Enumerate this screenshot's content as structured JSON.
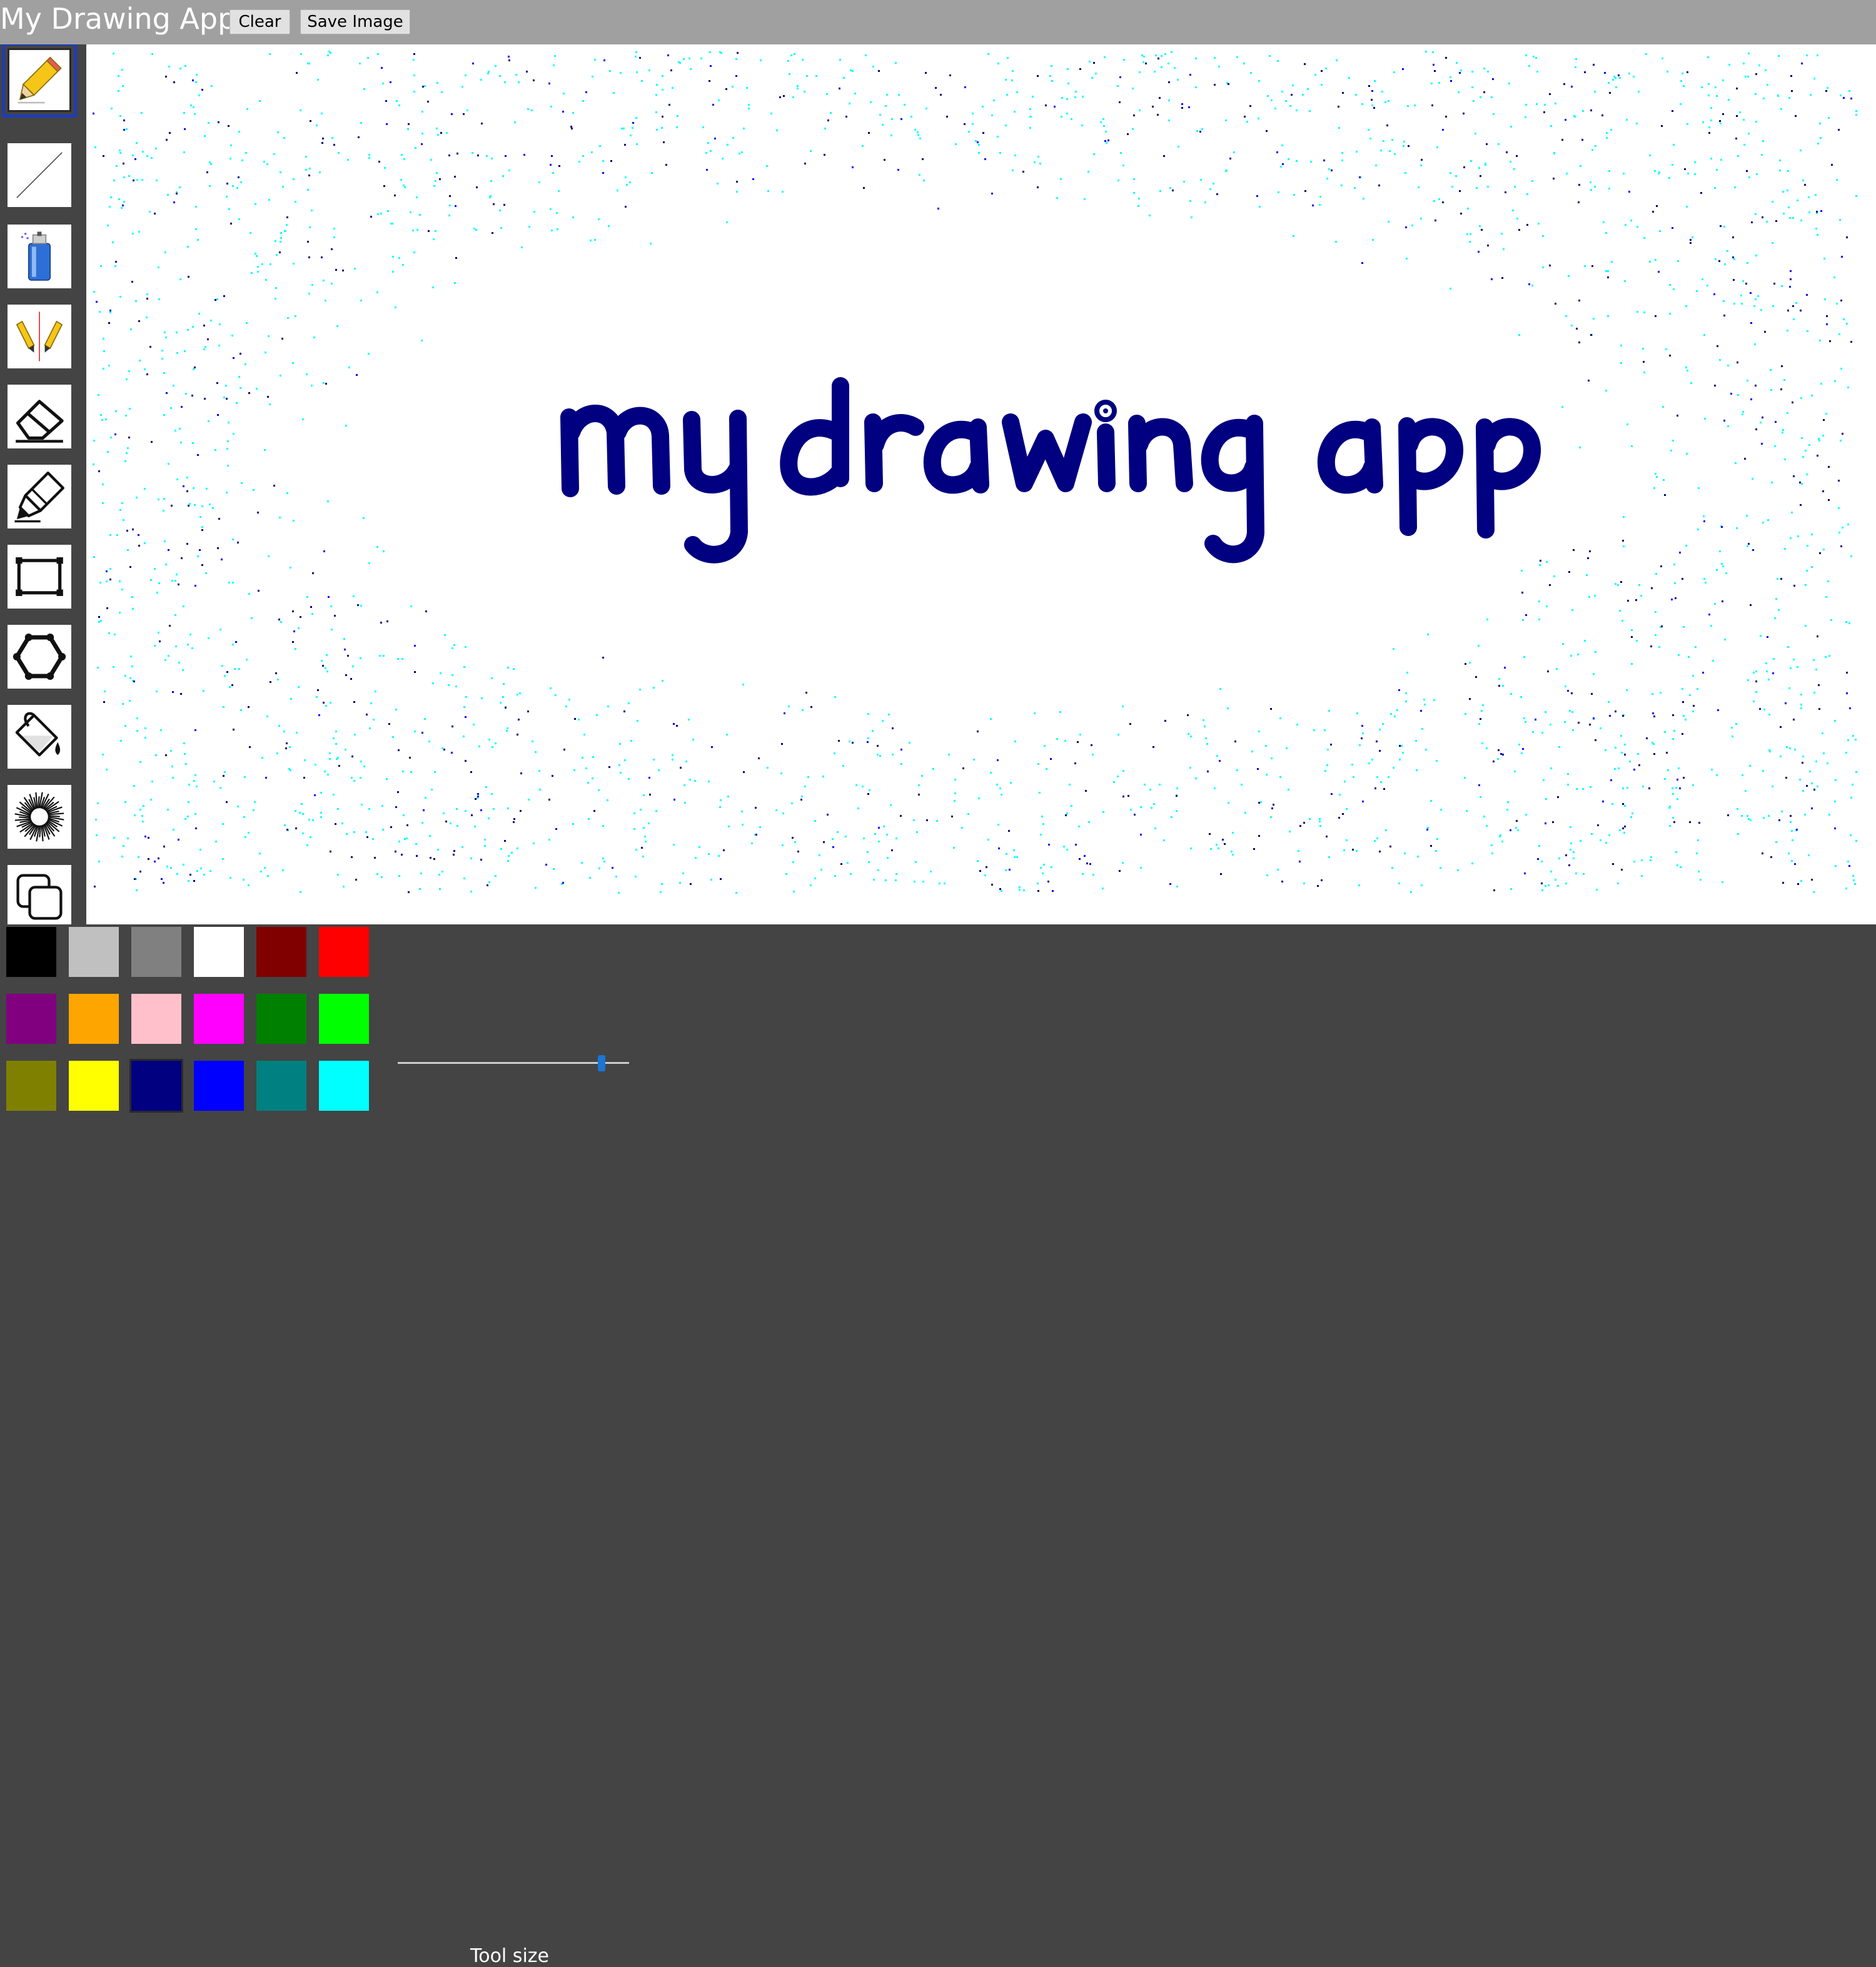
{
  "header": {
    "title": "My Drawing App",
    "clear_label": "Clear",
    "save_label": "Save Image"
  },
  "toolbar": {
    "tools": [
      {
        "name": "pencil-tool",
        "icon": "pencil-icon",
        "selected": true
      },
      {
        "name": "line-tool",
        "icon": "line-icon"
      },
      {
        "name": "spray-tool",
        "icon": "spray-can-icon"
      },
      {
        "name": "mirror-pencil-tool",
        "icon": "mirror-pencils-icon"
      },
      {
        "name": "eraser-tool",
        "icon": "eraser-icon"
      },
      {
        "name": "highlighter-tool",
        "icon": "marker-icon"
      },
      {
        "name": "rectangle-tool",
        "icon": "rectangle-icon"
      },
      {
        "name": "polygon-tool",
        "icon": "hexagon-icon"
      },
      {
        "name": "fill-tool",
        "icon": "paint-bucket-icon"
      },
      {
        "name": "pattern-stamp-tool",
        "icon": "spirograph-icon"
      },
      {
        "name": "copy-tool",
        "icon": "copy-icon"
      }
    ]
  },
  "canvas": {
    "drawn_text": "my drawing app",
    "ink_color": "#000080",
    "spray_colors": [
      "#00ffff",
      "#000080",
      "#0000ff"
    ]
  },
  "palette": {
    "colors": [
      "#000000",
      "#c0c0c0",
      "#808080",
      "#ffffff",
      "#800000",
      "#ff0000",
      "#800080",
      "#ffa500",
      "#ffc0cb",
      "#ff00ff",
      "#008000",
      "#00ff00",
      "#808000",
      "#ffff00",
      "#000080",
      "#0000ff",
      "#008080",
      "#00ffff"
    ],
    "selected": "#000080"
  },
  "tool_size": {
    "label": "Tool size",
    "value_fraction": 0.88
  }
}
